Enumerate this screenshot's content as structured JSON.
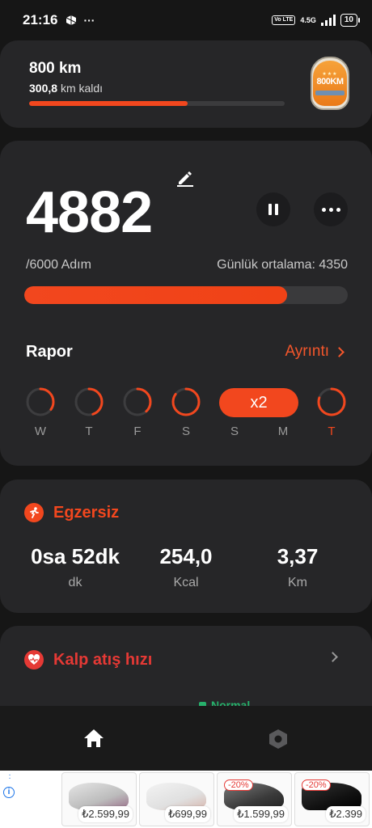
{
  "status_bar": {
    "time": "21:16",
    "network": "4.5G",
    "volte": "Vo LTE",
    "battery": "10"
  },
  "goal": {
    "title": "800 km",
    "remaining_value": "300,8",
    "remaining_suffix": "km kaldı",
    "progress": 0.62,
    "badge_text": "800KM"
  },
  "steps": {
    "count": "4882",
    "goal_text": "/6000 Adım",
    "average_text": "Günlük ortalama: 4350",
    "progress": 0.8137,
    "report_title": "Rapor",
    "details_link": "Ayrıntı",
    "days": [
      {
        "label": "W",
        "progress": 0.35,
        "today": false
      },
      {
        "label": "T",
        "progress": 0.45,
        "today": false
      },
      {
        "label": "F",
        "progress": 0.38,
        "today": false
      },
      {
        "label": "S",
        "progress": 0.85,
        "today": false
      },
      {
        "label": "S",
        "badge": "x2",
        "today": false
      },
      {
        "label": "M",
        "today": false
      },
      {
        "label": "T",
        "progress": 0.8,
        "today": true
      }
    ]
  },
  "exercise": {
    "title": "Egzersiz",
    "metrics": [
      {
        "value": "0sa 52dk",
        "unit": "dk"
      },
      {
        "value": "254,0",
        "unit": "Kcal"
      },
      {
        "value": "3,37",
        "unit": "Km"
      }
    ]
  },
  "heart": {
    "title": "Kalp atış hızı",
    "status": "Normal"
  },
  "colors": {
    "accent": "#f2471e",
    "card": "#262628",
    "background": "#161616",
    "success": "#27b06b"
  },
  "nav": {
    "home_icon": "home-icon",
    "settings_icon": "hexagon-settings-icon"
  },
  "ads": [
    {
      "price": "₺2.599,99"
    },
    {
      "price": "₺699,99"
    },
    {
      "price": "₺1.599,99",
      "discount": "-20%"
    },
    {
      "price": "₺2.399",
      "discount": "-20%"
    }
  ]
}
